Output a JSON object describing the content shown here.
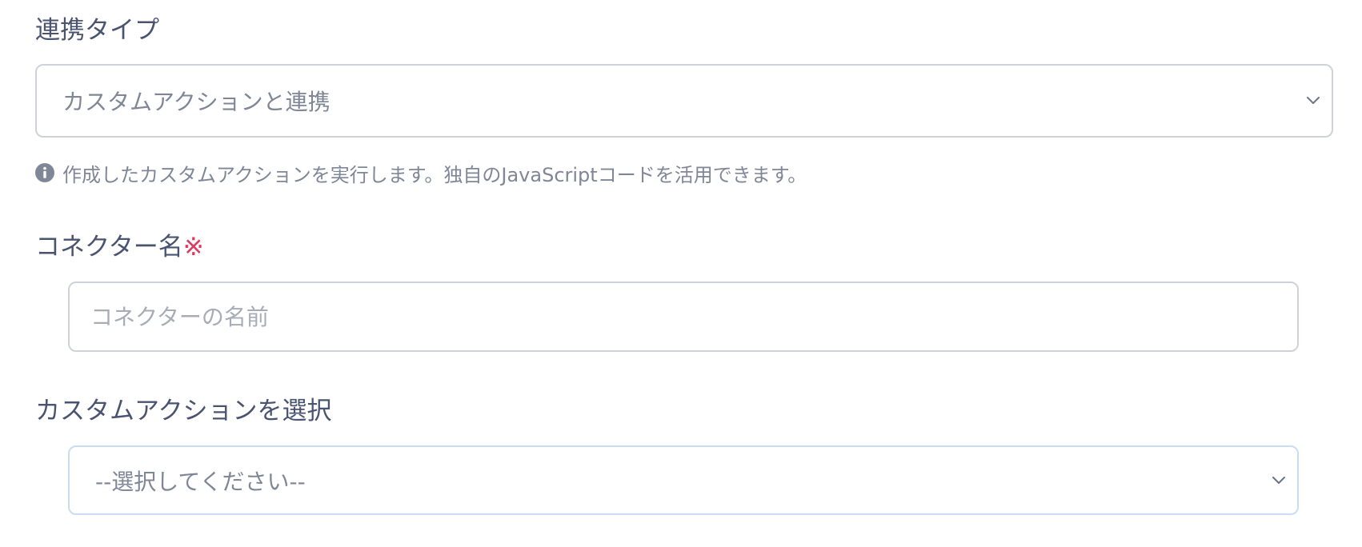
{
  "integration_type": {
    "label": "連携タイプ",
    "selected": "カスタムアクションと連携",
    "hint": "作成したカスタムアクションを実行します。独自のJavaScriptコードを活用できます。"
  },
  "connector_name": {
    "label": "コネクター名",
    "required_mark": "※",
    "placeholder": "コネクターの名前",
    "value": ""
  },
  "custom_action": {
    "label": "カスタムアクションを選択",
    "selected": "--選択してください--"
  },
  "icons": {
    "hint": "info-circle-icon",
    "dropdown": "chevron-down-icon"
  },
  "colors": {
    "text": "#4a5470",
    "muted": "#7f8797",
    "required": "#e0395f",
    "border": "#cfd2d8",
    "focus_border": "#c9dcf2"
  }
}
